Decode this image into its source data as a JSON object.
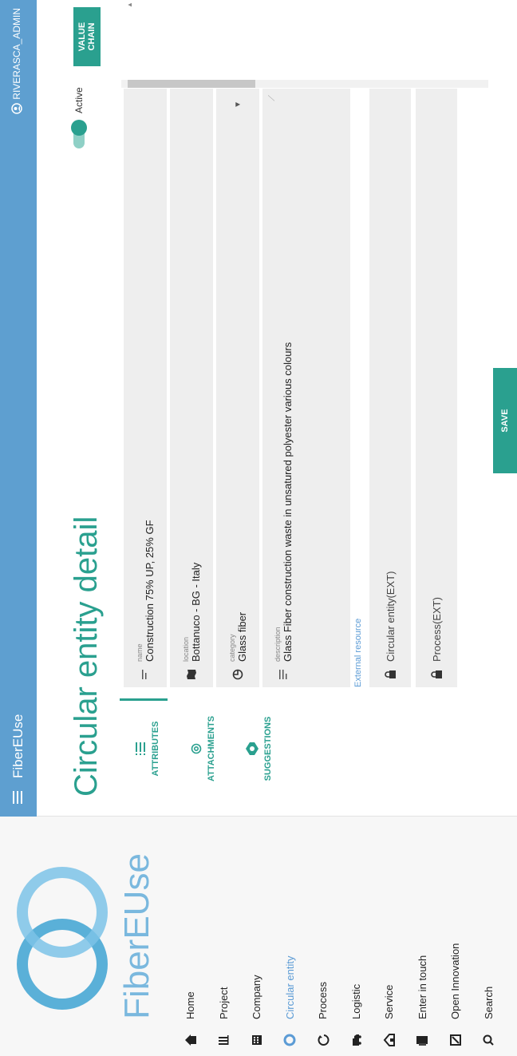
{
  "app": {
    "title": "FiberEUse",
    "user": "RIVERASCA_ADMIN"
  },
  "logo": {
    "text": "FiberEUse"
  },
  "nav": [
    {
      "label": "Home",
      "icon": "home-icon"
    },
    {
      "label": "Project",
      "icon": "project-icon"
    },
    {
      "label": "Company",
      "icon": "company-icon"
    },
    {
      "label": "Circular entity",
      "icon": "circular-entity-icon",
      "active": true
    },
    {
      "label": "Process",
      "icon": "process-icon"
    },
    {
      "label": "Logistic",
      "icon": "logistic-icon"
    },
    {
      "label": "Service",
      "icon": "service-icon"
    },
    {
      "label": "Enter in touch",
      "icon": "enter-in-touch-icon"
    },
    {
      "label": "Open Innovation",
      "icon": "open-innovation-icon"
    },
    {
      "label": "Search",
      "icon": "search-icon"
    }
  ],
  "page": {
    "title": "Circular entity detail"
  },
  "tabs": [
    {
      "label": "ATTRIBUTES",
      "icon": "list-icon"
    },
    {
      "label": "ATTACHMENTS",
      "icon": "paperclip-icon"
    },
    {
      "label": "SUGGESTIONS",
      "icon": "lightbulb-icon"
    }
  ],
  "status": {
    "label": "Active",
    "on": true
  },
  "buttons": {
    "value_chain": "VALUE CHAIN",
    "save": "SAVE"
  },
  "fields": {
    "name": {
      "label": "name",
      "value": "Construction 75% UP, 25% GF"
    },
    "location": {
      "label": "location",
      "value": "Bottanuco - BG - Italy"
    },
    "category": {
      "label": "category",
      "value": "Glass fiber"
    },
    "description": {
      "label": "description",
      "value": "Glass Fiber construction waste in unsatured polyester various colours"
    }
  },
  "external": {
    "label": "External resource",
    "items": [
      "Circular entity(EXT)",
      "Process(EXT)"
    ]
  },
  "colors": {
    "accent": "#2aa08f",
    "appbar": "#5e9fd0",
    "link": "#5b9bd5"
  }
}
